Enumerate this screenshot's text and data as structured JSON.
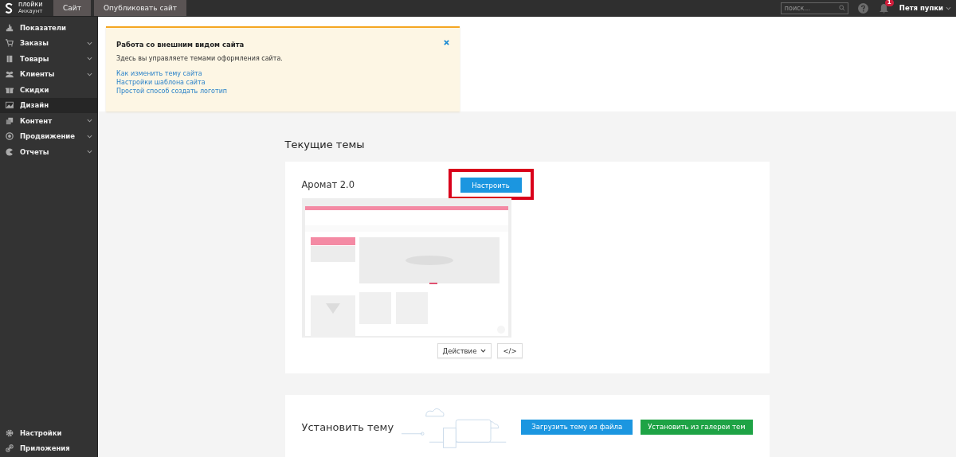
{
  "topbar": {
    "logo": {
      "name": "плойки",
      "subtitle": "Аккаунт"
    },
    "buttons": [
      "Сайт",
      "Опубликовать сайт"
    ],
    "search": {
      "placeholder": "поиск..."
    },
    "notifications": {
      "count": "1"
    },
    "user": "Петя пупки"
  },
  "sidebar": {
    "items": [
      {
        "label": "Показатели",
        "has_submenu": false,
        "selected": false
      },
      {
        "label": "Заказы",
        "has_submenu": true,
        "selected": false
      },
      {
        "label": "Товары",
        "has_submenu": true,
        "selected": false
      },
      {
        "label": "Клиенты",
        "has_submenu": true,
        "selected": false
      },
      {
        "label": "Скидки",
        "has_submenu": false,
        "selected": false
      },
      {
        "label": "Дизайн",
        "has_submenu": false,
        "selected": true
      },
      {
        "label": "Контент",
        "has_submenu": true,
        "selected": false
      },
      {
        "label": "Продвижение",
        "has_submenu": true,
        "selected": false
      },
      {
        "label": "Отчеты",
        "has_submenu": true,
        "selected": false
      }
    ],
    "bottom_items": [
      {
        "label": "Настройки",
        "selected": false
      },
      {
        "label": "Приложения",
        "selected": false
      }
    ]
  },
  "notice": {
    "title": "Работа со внешним видом сайта",
    "text": "Здесь вы управляете темами оформления сайта.",
    "links": [
      "Как изменить тему сайта",
      "Настройки шаблона сайта",
      "Простой способ создать логотип"
    ],
    "closable": true
  },
  "current_themes": {
    "heading": "Текущие темы",
    "themes": [
      {
        "name": "Аромат 2.0",
        "configure_button": "Настроить",
        "highlighted": true,
        "action_button": "Действие",
        "code_button": "</>"
      }
    ]
  },
  "install": {
    "heading": "Установить тему",
    "buttons": [
      {
        "label": "Загрузить тему из файла",
        "kind": "primary"
      },
      {
        "label": "Установить из галереи тем",
        "kind": "success"
      }
    ]
  }
}
